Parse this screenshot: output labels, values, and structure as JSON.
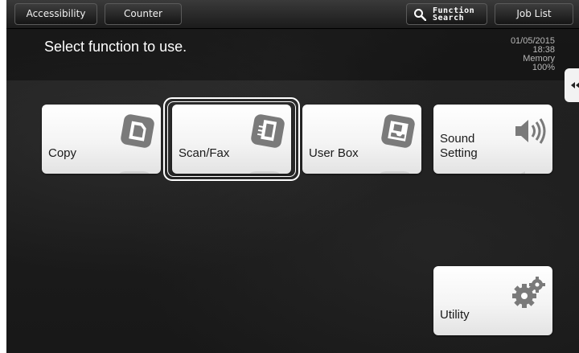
{
  "topbar": {
    "accessibility_label": "Accessibility",
    "counter_label": "Counter",
    "function_search_line1": "Function",
    "function_search_line2": "Search",
    "job_list_label": "Job List"
  },
  "header": {
    "prompt": "Select function to use.",
    "date": "01/05/2015",
    "time": "18:38",
    "memory_label": "Memory",
    "memory_value": "100%"
  },
  "tiles": [
    {
      "label": "Copy",
      "icon": "copy-icon"
    },
    {
      "label": "Scan/Fax",
      "icon": "scan-fax-icon",
      "selected": true
    },
    {
      "label": "User Box",
      "icon": "user-box-icon"
    },
    {
      "label": "Sound\nSetting",
      "icon": "sound-setting-icon"
    },
    {
      "label": "Utility",
      "icon": "utility-gear-icon"
    }
  ],
  "icons": {
    "side_tab": "collapse-arrow-icon",
    "search": "search-icon"
  },
  "colors": {
    "icon_gray": "#7a7a7a",
    "tile_white": "#ffffff",
    "background": "#1e1e1e"
  }
}
